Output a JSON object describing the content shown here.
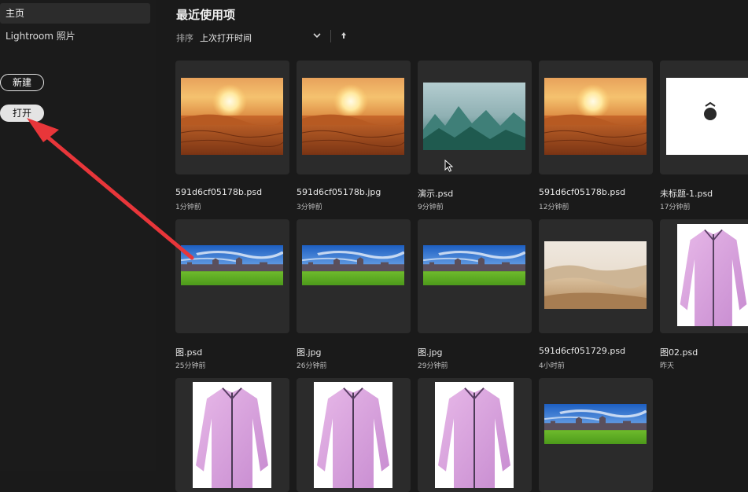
{
  "sidebar": {
    "home_label": "主页",
    "lightroom_label": "Lightroom 照片",
    "new_label": "新建",
    "open_label": "打开"
  },
  "main": {
    "title": "最近使用项",
    "sort_label": "排序",
    "sort_value": "上次打开时间",
    "files": [
      {
        "name": "591d6cf05178b.psd",
        "time": "1分钟前",
        "thumb": "desert-sunset"
      },
      {
        "name": "591d6cf05178b.jpg",
        "time": "3分钟前",
        "thumb": "desert-sunset"
      },
      {
        "name": "演示.psd",
        "time": "9分钟前",
        "thumb": "misty-mountains"
      },
      {
        "name": "591d6cf05178b.psd",
        "time": "12分钟前",
        "thumb": "desert-sunset"
      },
      {
        "name": "未标题-1.psd",
        "time": "17分钟前",
        "thumb": "white-canvas"
      },
      {
        "name": "图.psd",
        "time": "25分钟前",
        "thumb": "castle-lawn"
      },
      {
        "name": "图.jpg",
        "time": "26分钟前",
        "thumb": "castle-lawn"
      },
      {
        "name": "图.jpg",
        "time": "29分钟前",
        "thumb": "castle-lawn"
      },
      {
        "name": "591d6cf051729.psd",
        "time": "4小时前",
        "thumb": "sand-dunes"
      },
      {
        "name": "图02.psd",
        "time": "昨天",
        "thumb": "pink-shirt"
      },
      {
        "name": "",
        "time": "",
        "thumb": "pink-shirt"
      },
      {
        "name": "",
        "time": "",
        "thumb": "pink-shirt"
      },
      {
        "name": "",
        "time": "",
        "thumb": "pink-shirt"
      },
      {
        "name": "",
        "time": "",
        "thumb": "castle-lawn"
      }
    ]
  },
  "colors": {
    "annotation_arrow": "#e8363a",
    "background": "#1a1a1a",
    "tile": "#2b2b2b"
  }
}
